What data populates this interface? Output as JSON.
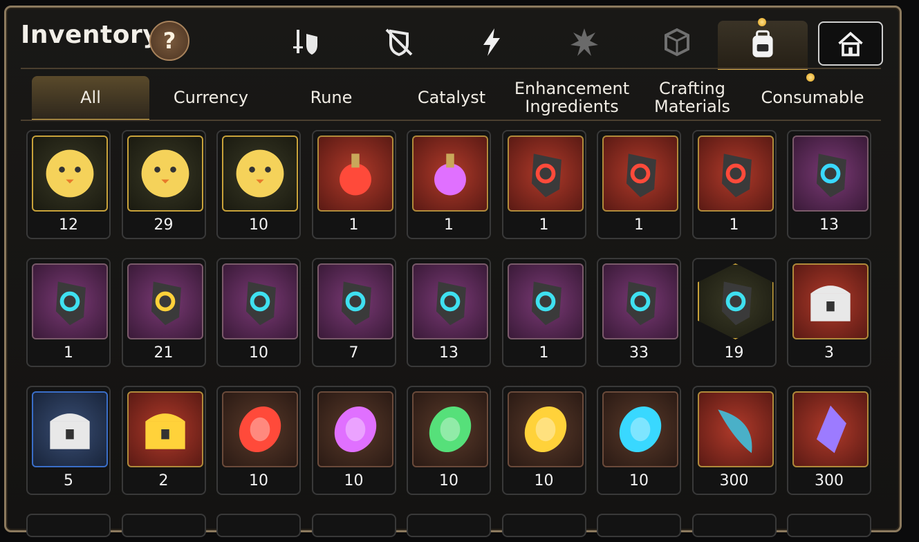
{
  "header": {
    "title": "Inventory",
    "help_label": "?"
  },
  "category_icons": [
    {
      "name": "sword-shield-icon"
    },
    {
      "name": "crossed-shield-icon"
    },
    {
      "name": "lightning-icon"
    },
    {
      "name": "splash-icon"
    },
    {
      "name": "cube-icon"
    },
    {
      "name": "backpack-icon",
      "active": true
    },
    {
      "name": "house-icon"
    }
  ],
  "tabs": [
    {
      "label": "All",
      "active": true
    },
    {
      "label": "Currency"
    },
    {
      "label": "Rune"
    },
    {
      "label": "Catalyst"
    },
    {
      "label": "Enhancement Ingredients"
    },
    {
      "label": "Crafting Materials"
    },
    {
      "label": "Consumable"
    }
  ],
  "items": [
    {
      "icon": "yellow-bird-coin-icon",
      "count": "12"
    },
    {
      "icon": "green-bird-coin-icon",
      "count": "29"
    },
    {
      "icon": "leaf-bird-coin-icon",
      "count": "10"
    },
    {
      "icon": "red-potion-icon",
      "count": "1"
    },
    {
      "icon": "pink-potion-icon",
      "count": "1"
    },
    {
      "icon": "red-ring-rune-icon",
      "count": "1"
    },
    {
      "icon": "red-star-rune-icon",
      "count": "1"
    },
    {
      "icon": "red-necklace-rune-icon",
      "count": "1"
    },
    {
      "icon": "cyan-rune-icon",
      "count": "13"
    },
    {
      "icon": "ring-rune-icon",
      "count": "1"
    },
    {
      "icon": "gold-rune-icon",
      "count": "21"
    },
    {
      "icon": "armor-rune-icon",
      "count": "10"
    },
    {
      "icon": "boot-rune-icon",
      "count": "7"
    },
    {
      "icon": "sword-rune-icon",
      "count": "13"
    },
    {
      "icon": "necklace-rune-icon",
      "count": "1"
    },
    {
      "icon": "hammer-rune-icon",
      "count": "33"
    },
    {
      "icon": "stone-star-rune-icon",
      "count": "19"
    },
    {
      "icon": "white-chest-icon",
      "count": "3"
    },
    {
      "icon": "silver-chest-icon",
      "count": "5"
    },
    {
      "icon": "gold-chest-icon",
      "count": "2"
    },
    {
      "icon": "fire-orb-icon",
      "count": "10"
    },
    {
      "icon": "moon-orb-icon",
      "count": "10"
    },
    {
      "icon": "leaf-orb-icon",
      "count": "10"
    },
    {
      "icon": "sun-orb-icon",
      "count": "10"
    },
    {
      "icon": "ice-orb-icon",
      "count": "10"
    },
    {
      "icon": "scale-feather-icon",
      "count": "300"
    },
    {
      "icon": "crystal-icon",
      "count": "300"
    }
  ],
  "colors": {
    "accent": "#e1b24e",
    "panel_border": "#8c7a5e"
  }
}
